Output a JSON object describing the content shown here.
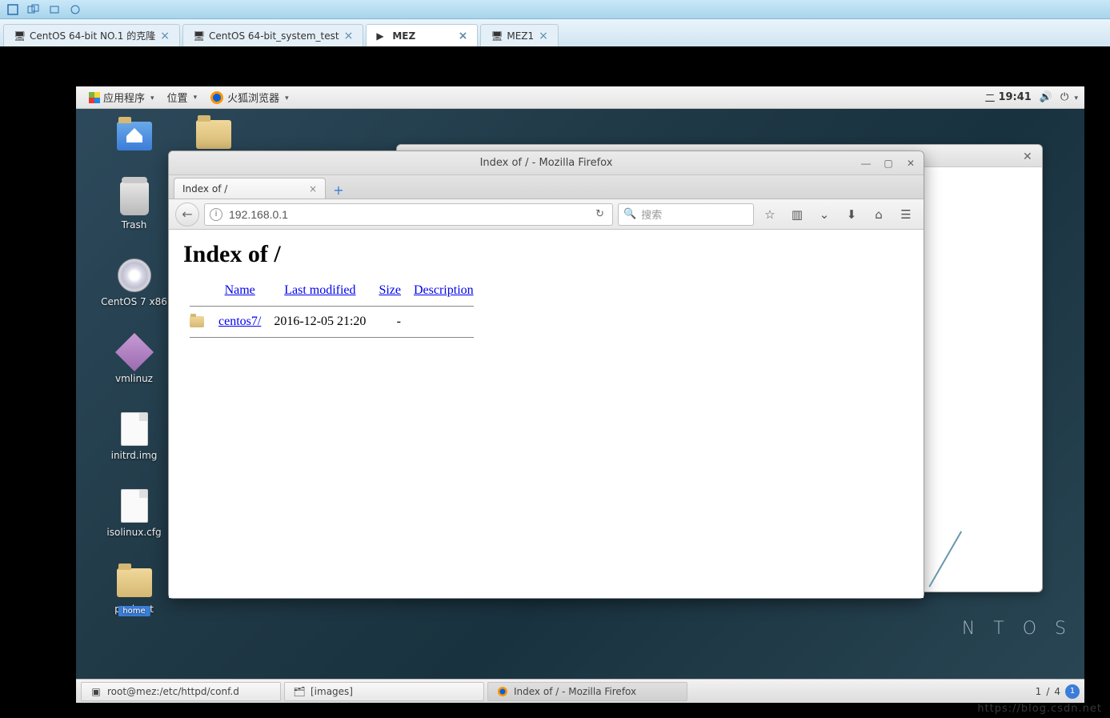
{
  "vmware": {
    "tabs": [
      {
        "label": "CentOS 64-bit NO.1 的克隆",
        "active": false
      },
      {
        "label": "CentOS 64-bit_system_test",
        "active": false
      },
      {
        "label": "MEZ",
        "active": true
      },
      {
        "label": "MEZ1",
        "active": false
      }
    ]
  },
  "gnome": {
    "menu": {
      "apps": "应用程序",
      "places": "位置",
      "firefox": "火狐浏览器"
    },
    "clock_day": "二",
    "clock_time": "19:41",
    "brand": "N T O S"
  },
  "desktop_icons": {
    "home": "home",
    "trash": "Trash",
    "disc": "CentOS 7 x86",
    "vmlinuz": "vmlinuz",
    "initrd": "initrd.img",
    "isolinux": "isolinux.cfg",
    "pxeboot": "pxeboot"
  },
  "firefox": {
    "window_title": "Index of / - Mozilla Firefox",
    "tab_title": "Index of /",
    "url": "192.168.0.1",
    "search_placeholder": "搜索"
  },
  "apache": {
    "heading": "Index of /",
    "cols": {
      "name": "Name",
      "modified": "Last modified",
      "size": "Size",
      "desc": "Description"
    },
    "rows": [
      {
        "name": "centos7/",
        "modified": "2016-12-05 21:20",
        "size": "-",
        "desc": ""
      }
    ]
  },
  "taskbar": {
    "items": [
      {
        "label": "root@mez:/etc/httpd/conf.d",
        "icon": "terminal"
      },
      {
        "label": "[images]",
        "icon": "files"
      },
      {
        "label": "Index of / - Mozilla Firefox",
        "icon": "firefox",
        "active": true
      }
    ],
    "pager": {
      "current": "1",
      "total": "4"
    }
  }
}
